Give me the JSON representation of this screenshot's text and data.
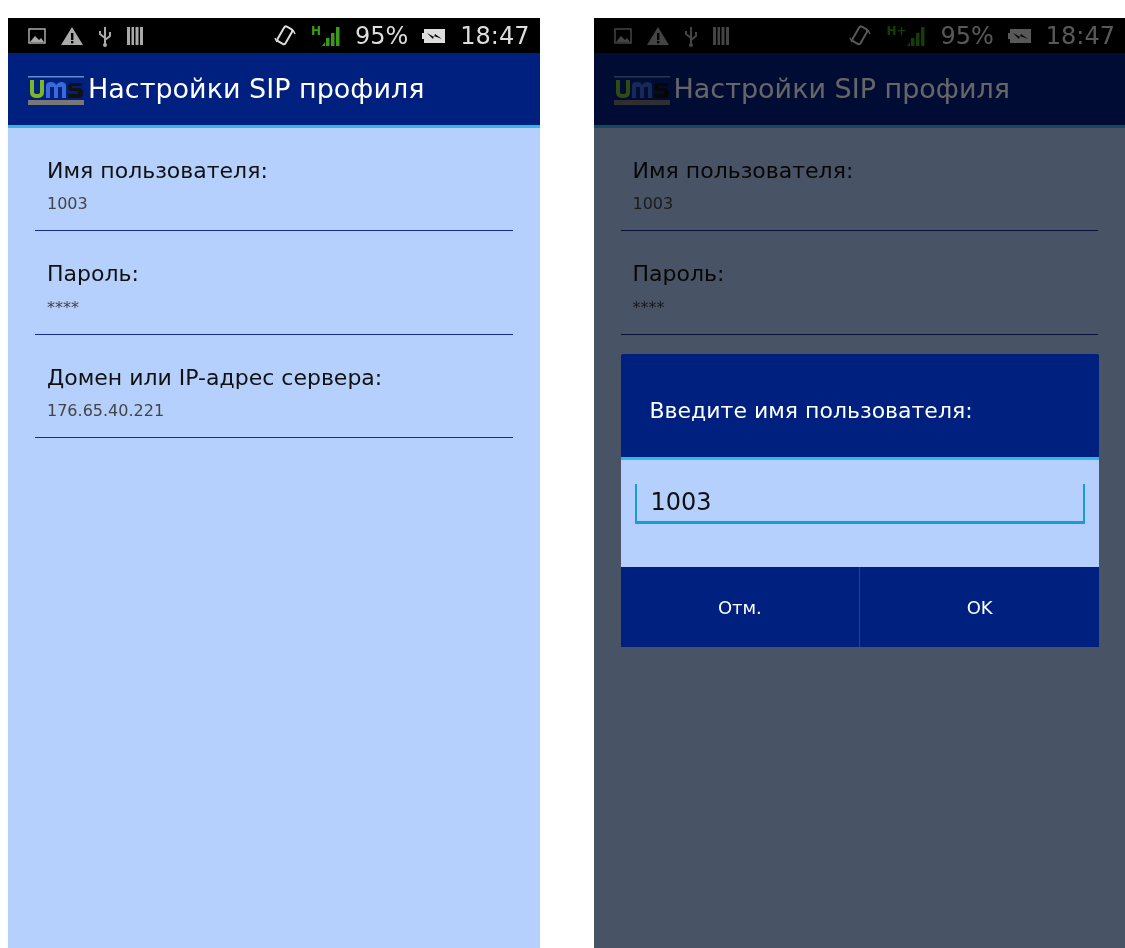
{
  "screens": [
    {
      "status_bar": {
        "network": "H",
        "battery": "95%",
        "time": "18:47"
      },
      "app_bar": {
        "title": "Настройки SIP профиля"
      },
      "settings": [
        {
          "label": "Имя пользователя:",
          "value": "1003"
        },
        {
          "label": "Пароль:",
          "value": "****"
        },
        {
          "label": "Домен или IP-адрес сервера:",
          "value": "176.65.40.221"
        }
      ],
      "dimmed": false
    },
    {
      "status_bar": {
        "network": "H+",
        "battery": "95%",
        "time": "18:47"
      },
      "app_bar": {
        "title": "Настройки SIP профиля"
      },
      "settings": [
        {
          "label": "Имя пользователя:",
          "value": "1003"
        },
        {
          "label": "Пароль:",
          "value": "****"
        }
      ],
      "dimmed": true,
      "dialog": {
        "title": "Введите имя пользователя:",
        "value": "1003",
        "buttons": [
          "Отм.",
          "OK"
        ]
      }
    }
  ]
}
